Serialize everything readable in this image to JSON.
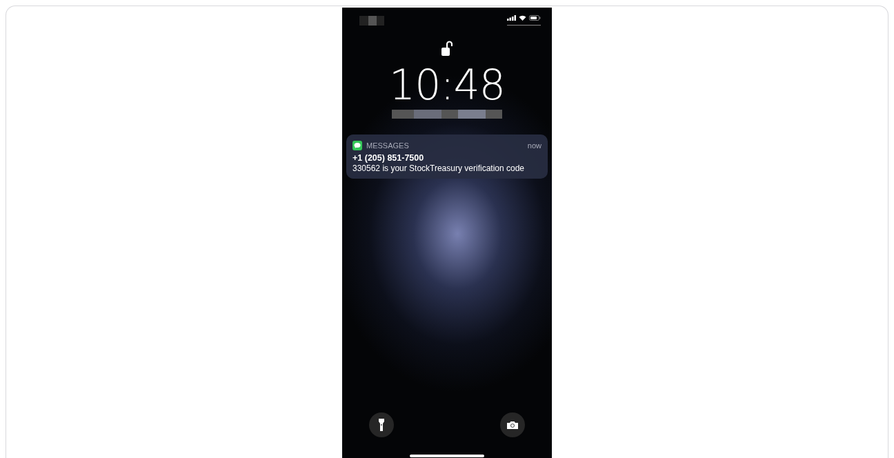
{
  "lock_screen": {
    "time": "10:48",
    "locked": false
  },
  "notification": {
    "app": "MESSAGES",
    "when": "now",
    "sender": "+1 (205) 851-7500",
    "body": "330562 is your StockTreasury verification code"
  }
}
